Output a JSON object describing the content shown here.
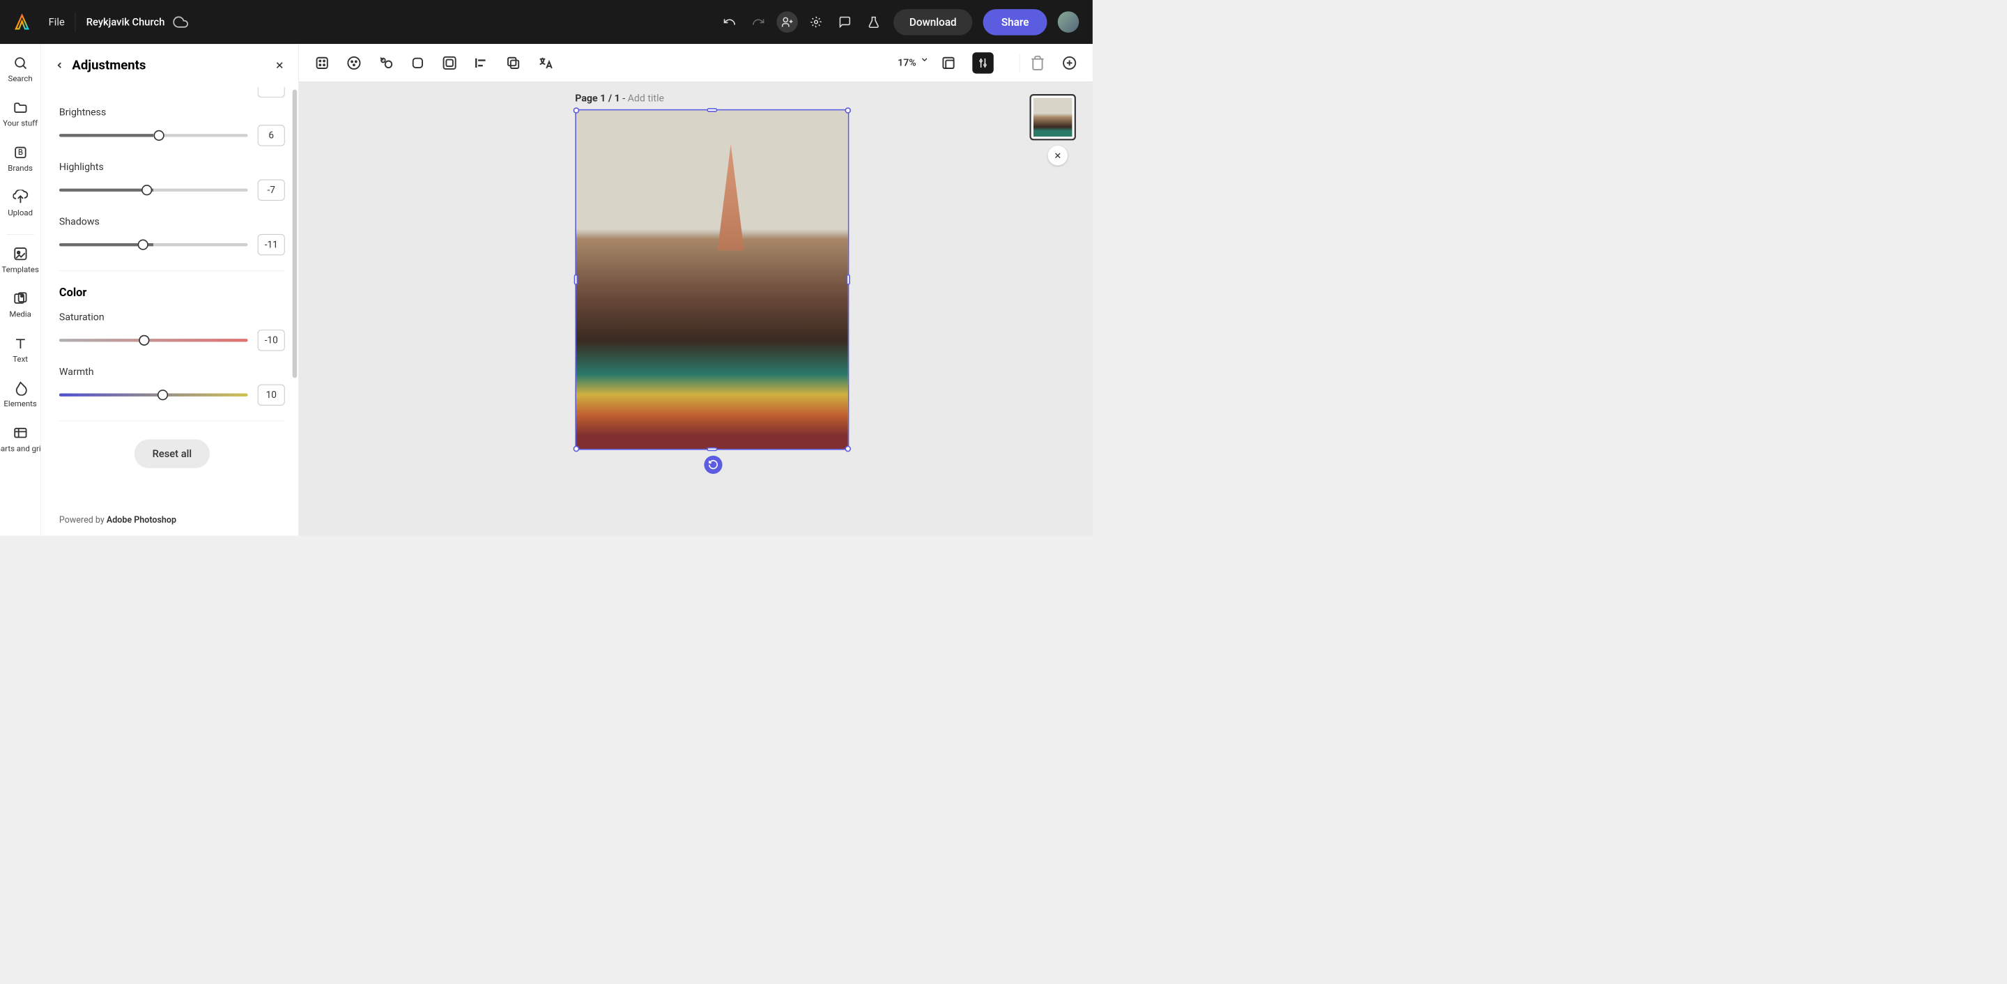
{
  "header": {
    "file_menu": "File",
    "doc_title": "Reykjavik Church",
    "download": "Download",
    "share": "Share"
  },
  "rail": {
    "search": "Search",
    "your_stuff": "Your stuff",
    "brands": "Brands",
    "upload": "Upload",
    "templates": "Templates",
    "media": "Media",
    "text": "Text",
    "elements": "Elements",
    "charts": "Charts and grids"
  },
  "panel": {
    "title": "Adjustments",
    "brightness_label": "Brightness",
    "brightness_value": "6",
    "highlights_label": "Highlights",
    "highlights_value": "-7",
    "shadows_label": "Shadows",
    "shadows_value": "-11",
    "color_heading": "Color",
    "saturation_label": "Saturation",
    "saturation_value": "-10",
    "warmth_label": "Warmth",
    "warmth_value": "10",
    "reset": "Reset all",
    "powered_prefix": "Powered by ",
    "powered_brand": "Adobe Photoshop"
  },
  "canvas": {
    "zoom": "17%",
    "page_prefix": "Page 1 / 1",
    "page_sep": " - ",
    "add_title": "Add title"
  }
}
